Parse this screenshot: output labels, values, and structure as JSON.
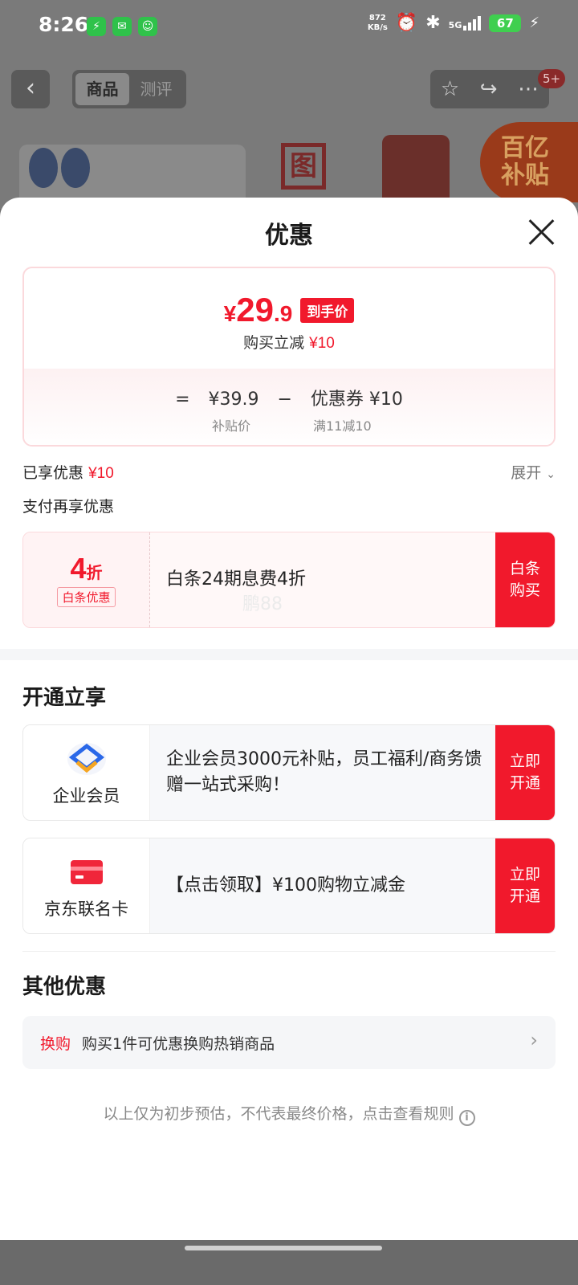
{
  "status_bar": {
    "time": "8:26",
    "net_speed_value": "872",
    "net_speed_unit": "KB/s",
    "network": "5G",
    "battery": "67",
    "icons": [
      "charging-app-icon",
      "messages-icon",
      "wechat-icon",
      "alarm-icon",
      "bluetooth-icon",
      "signal-icon",
      "battery-icon"
    ]
  },
  "nav": {
    "tabs": [
      "商品",
      "测评"
    ],
    "active_tab": "商品",
    "badge": "5+"
  },
  "background": {
    "subsidy_badge_line1": "百亿",
    "subsidy_badge_line2": "补贴",
    "seal_char": "图"
  },
  "sheet": {
    "title": "优惠",
    "price_card": {
      "currency": "¥",
      "price_int": "29",
      "price_dec": ".9",
      "price_tag": "到手价",
      "reduce_text": "购买立减",
      "reduce_amount": "¥10",
      "eq": "=",
      "subsidy_price": "¥39.9",
      "minus": "−",
      "coupon_text": "优惠券 ¥10",
      "subsidy_label": "补贴价",
      "coupon_rule": "满11减10"
    },
    "enjoyed_label": "已享优惠",
    "enjoyed_amount": "¥10",
    "expand_label": "展开",
    "pay_more_label": "支付再享优惠",
    "baitiao": {
      "discount_num": "4",
      "discount_unit": "折",
      "tag": "白条优惠",
      "desc": "白条24期息费4折",
      "button": "白条购买",
      "watermark": "鹏88"
    },
    "open_section_title": "开通立享",
    "member": {
      "name": "企业会员",
      "desc": "企业会员3000元补贴，员工福利/商务馈赠一站式采购！",
      "button": "立即开通"
    },
    "card": {
      "name": "京东联名卡",
      "desc": "【点击领取】¥100购物立减金",
      "button": "立即开通"
    },
    "other_section_title": "其他优惠",
    "other_tag": "换购",
    "other_text": "购买1件可优惠换购热销商品",
    "disclaimer": "以上仅为初步预估，不代表最终价格，点击查看规则"
  },
  "colors": {
    "accent_red": "#f1192c",
    "overlay": "#6d6d6d"
  }
}
